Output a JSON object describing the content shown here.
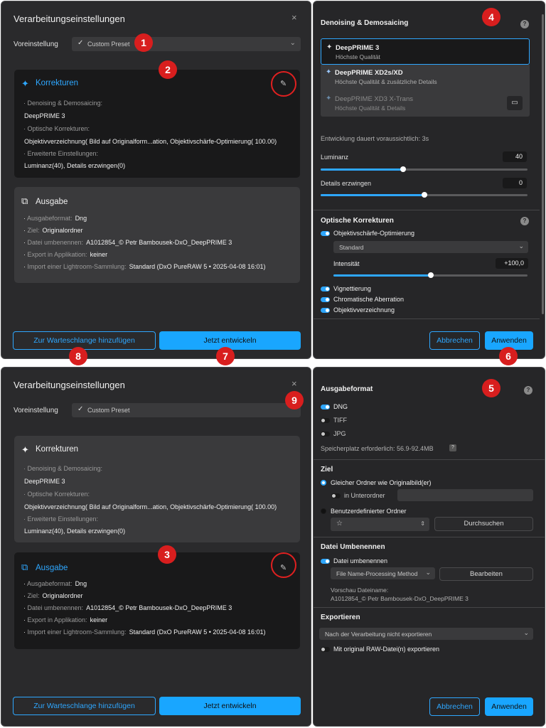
{
  "dialog": {
    "title": "Verarbeitungseinstellungen",
    "close_glyph": "×",
    "preset_label": "Voreinstellung",
    "preset_value": "Custom Preset",
    "btn_queue": "Zur Warteschlange hinzufügen",
    "btn_develop": "Jetzt entwickeln"
  },
  "korrekturen": {
    "title": "Korrekturen",
    "denoise_label": "Denoising & Demosaicing:",
    "denoise_value": "DeepPRIME 3",
    "optical_label": "Optische Korrekturen:",
    "optical_value": "Objektivverzeichnung( Bild auf Originalform...ation, Objektivschärfe-Optimierung( 100.00)",
    "advanced_label": "Erweiterte Einstellungen:",
    "advanced_value": "Luminanz(40), Details erzwingen(0)"
  },
  "ausgabe": {
    "title": "Ausgabe",
    "rows": [
      {
        "k": "Ausgabeformat:",
        "v": "Dng"
      },
      {
        "k": "Ziel:",
        "v": "Originalordner"
      },
      {
        "k": "Datei umbenennen:",
        "v": "A1012854_© Petr Bambousek-DxO_DeepPRIME 3"
      },
      {
        "k": "Export in Applikation:",
        "v": "keiner"
      },
      {
        "k": "Import einer Lightroom-Sammlung:",
        "v": "Standard (DxO PureRAW 5 • 2025-04-08 16:01)"
      }
    ]
  },
  "denoise_panel": {
    "title": "Denoising & Demosaicing",
    "options": [
      {
        "name": "DeepPRIME 3",
        "desc": "Höchste Qualität"
      },
      {
        "name": "DeepPRIME XD2s/XD",
        "desc": "Höchste Qualität & zusätzliche Details"
      },
      {
        "name": "DeepPRIME XD3 X-Trans",
        "desc": "Höchste Qualität & Details"
      }
    ],
    "estimate": "Entwicklung dauert voraussichtlich: 3s",
    "luminance_label": "Luminanz",
    "luminance_value": "40",
    "luminance_fraction": 0.4,
    "details_label": "Details erzwingen",
    "details_value": "0",
    "details_fraction": 0.5,
    "optical_title": "Optische Korrekturen",
    "sharpness_label": "Objektivschärfe-Optimierung",
    "sharpness_mode": "Standard",
    "intensity_label": "Intensität",
    "intensity_value": "+100,0",
    "intensity_fraction": 0.5,
    "vignette_label": "Vignettierung",
    "chroma_label": "Chromatische Aberration",
    "distortion_label": "Objektivverzeichnung",
    "btn_cancel": "Abbrechen",
    "btn_apply": "Anwenden"
  },
  "output_panel": {
    "format_title": "Ausgabeformat",
    "dng": "DNG",
    "tiff": "TIFF",
    "jpg": "JPG",
    "storage": "Speicherplatz erforderlich: 56.9-92.4MB",
    "storage_help": "?",
    "dest_title": "Ziel",
    "same_folder": "Gleicher Ordner wie Originalbild(er)",
    "subfolder": "in Unterordner",
    "custom_folder": "Benutzerdefinierter Ordner",
    "browse": "Durchsuchen",
    "rename_title": "Datei Umbenennen",
    "rename_toggle": "Datei umbenennen",
    "rename_method": "File Name-Processing Method",
    "edit": "Bearbeiten",
    "preview_label": "Vorschau Dateiname:",
    "preview_value": "A1012854_© Petr Bambousek-DxO_DeepPRIME 3",
    "export_title": "Exportieren",
    "export_mode": "Nach der Verarbeitung nicht exportieren",
    "export_raw": "Mit original RAW-Datei(n) exportieren",
    "btn_cancel": "Abbrechen",
    "btn_apply": "Anwenden"
  },
  "badges": [
    "1",
    "2",
    "3",
    "4",
    "5",
    "6",
    "7",
    "8",
    "9"
  ],
  "help_glyph": "?",
  "colors": {
    "accent": "#2ea7ff",
    "badge": "#d81e1e",
    "panel": "#2a2a2c"
  }
}
